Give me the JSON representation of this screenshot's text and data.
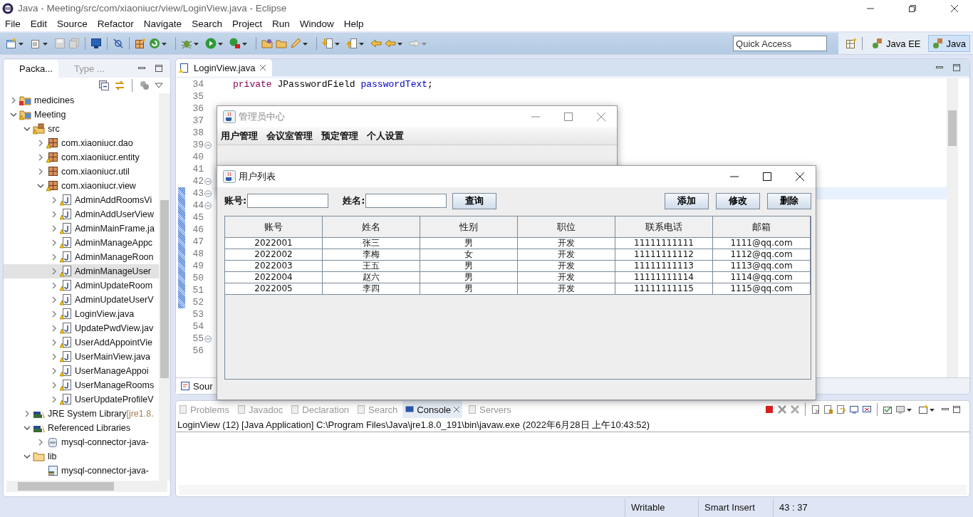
{
  "window": {
    "title": "Java - Meeting/src/com/xiaoniucr/view/LoginView.java - Eclipse"
  },
  "menu_bar": [
    "File",
    "Edit",
    "Source",
    "Refactor",
    "Navigate",
    "Search",
    "Project",
    "Run",
    "Window",
    "Help"
  ],
  "quick_access": {
    "placeholder": "Quick Access"
  },
  "perspectives": [
    {
      "label": "Java EE",
      "selected": false
    },
    {
      "label": "Java",
      "selected": true
    }
  ],
  "package_explorer": {
    "tabs": [
      {
        "label": "Packa...",
        "selected": true
      },
      {
        "label": "Type ...",
        "selected": false
      }
    ],
    "tree": [
      {
        "label": "medicines",
        "kind": "project",
        "warning": false,
        "error": true,
        "expanded": false,
        "selected": false
      },
      {
        "label": "Meeting",
        "kind": "project",
        "warning": true,
        "error": false,
        "expanded": true,
        "selected": false,
        "children": [
          {
            "label": "src",
            "kind": "source-folder",
            "warning": true,
            "error": false,
            "expanded": true,
            "selected": false,
            "children": [
              {
                "label": "com.xiaoniucr.dao",
                "kind": "package",
                "warning": true,
                "error": false,
                "expanded": false,
                "selected": false
              },
              {
                "label": "com.xiaoniucr.entity",
                "kind": "package",
                "warning": true,
                "error": false,
                "expanded": false,
                "selected": false
              },
              {
                "label": "com.xiaoniucr.util",
                "kind": "package",
                "warning": false,
                "error": false,
                "expanded": false,
                "selected": false
              },
              {
                "label": "com.xiaoniucr.view",
                "kind": "package",
                "warning": true,
                "error": false,
                "expanded": true,
                "selected": false,
                "children": [
                  {
                    "label": "AdminAddRoomsVi",
                    "kind": "java-file",
                    "warning": true,
                    "error": false,
                    "expanded": false,
                    "selected": false
                  },
                  {
                    "label": "AdminAddUserView",
                    "kind": "java-file",
                    "warning": true,
                    "error": false,
                    "expanded": false,
                    "selected": false
                  },
                  {
                    "label": "AdminMainFrame.ja",
                    "kind": "java-file",
                    "warning": true,
                    "error": false,
                    "expanded": false,
                    "selected": false
                  },
                  {
                    "label": "AdminManageAppc",
                    "kind": "java-file",
                    "warning": true,
                    "error": false,
                    "expanded": false,
                    "selected": false
                  },
                  {
                    "label": "AdminManageRoon",
                    "kind": "java-file",
                    "warning": true,
                    "error": false,
                    "expanded": false,
                    "selected": false
                  },
                  {
                    "label": "AdminManageUser",
                    "kind": "java-file",
                    "warning": true,
                    "error": false,
                    "expanded": false,
                    "selected": true
                  },
                  {
                    "label": "AdminUpdateRoom",
                    "kind": "java-file",
                    "warning": true,
                    "error": false,
                    "expanded": false,
                    "selected": false
                  },
                  {
                    "label": "AdminUpdateUserV",
                    "kind": "java-file",
                    "warning": true,
                    "error": false,
                    "expanded": false,
                    "selected": false
                  },
                  {
                    "label": "LoginView.java",
                    "kind": "java-file",
                    "warning": true,
                    "error": false,
                    "expanded": false,
                    "selected": false
                  },
                  {
                    "label": "UpdatePwdView.jav",
                    "kind": "java-file",
                    "warning": true,
                    "error": false,
                    "expanded": false,
                    "selected": false
                  },
                  {
                    "label": "UserAddAppointVie",
                    "kind": "java-file",
                    "warning": true,
                    "error": false,
                    "expanded": false,
                    "selected": false
                  },
                  {
                    "label": "UserMainView.java",
                    "kind": "java-file",
                    "warning": true,
                    "error": false,
                    "expanded": false,
                    "selected": false
                  },
                  {
                    "label": "UserManageAppoi",
                    "kind": "java-file",
                    "warning": true,
                    "error": false,
                    "expanded": false,
                    "selected": false
                  },
                  {
                    "label": "UserManageRooms",
                    "kind": "java-file",
                    "warning": true,
                    "error": false,
                    "expanded": false,
                    "selected": false
                  },
                  {
                    "label": "UserUpdateProfileV",
                    "kind": "java-file",
                    "warning": true,
                    "error": false,
                    "expanded": false,
                    "selected": false
                  }
                ]
              }
            ]
          },
          {
            "label": "JRE System Library",
            "suffix": "[jre1.8.",
            "kind": "library",
            "warning": false,
            "error": false,
            "expanded": false,
            "selected": false
          },
          {
            "label": "Referenced Libraries",
            "kind": "library",
            "warning": false,
            "error": false,
            "expanded": true,
            "selected": false,
            "children": [
              {
                "label": "mysql-connector-java-",
                "kind": "jar",
                "warning": false,
                "error": false,
                "expanded": false,
                "selected": false
              }
            ]
          },
          {
            "label": "lib",
            "kind": "folder",
            "warning": false,
            "error": false,
            "expanded": true,
            "selected": false,
            "children": [
              {
                "label": "mysql-connector-java-",
                "kind": "jar-file",
                "warning": false,
                "error": false,
                "selected": false
              }
            ]
          }
        ]
      }
    ]
  },
  "editor": {
    "tabs": [
      {
        "label": "LoginView.java",
        "selected": true
      }
    ],
    "lines": [
      {
        "number": "34",
        "code": [
          {
            "text": "private",
            "kind": "keyword"
          },
          {
            "text": " JPasswordField ",
            "kind": "plain"
          },
          {
            "text": "passwordText",
            "kind": "field"
          },
          {
            "text": ";",
            "kind": "plain"
          }
        ]
      },
      {
        "number": "35"
      },
      {
        "number": "36"
      },
      {
        "number": "37"
      },
      {
        "number": "38"
      },
      {
        "number": "39",
        "fold": true
      },
      {
        "number": "40"
      },
      {
        "number": "41"
      },
      {
        "number": "42",
        "fold": true
      },
      {
        "number": "43",
        "fold": true,
        "current": true,
        "changed": true
      },
      {
        "number": "44",
        "fold": true,
        "changed": true
      },
      {
        "number": "45",
        "changed": true
      },
      {
        "number": "46",
        "changed": true
      },
      {
        "number": "47",
        "changed": true
      },
      {
        "number": "48",
        "changed": true
      },
      {
        "number": "49",
        "changed": true
      },
      {
        "number": "50",
        "changed": true
      },
      {
        "number": "51",
        "changed": true
      },
      {
        "number": "52",
        "changed": true
      },
      {
        "number": "53"
      },
      {
        "number": "54"
      },
      {
        "number": "55",
        "fold": true
      },
      {
        "number": "56"
      }
    ],
    "bottom_tabs": [
      {
        "label": "Sour",
        "selected": true
      }
    ]
  },
  "console": {
    "tabs": [
      {
        "label": "Problems",
        "selected": false
      },
      {
        "label": "Javadoc",
        "selected": false
      },
      {
        "label": "Declaration",
        "selected": false
      },
      {
        "label": "Search",
        "selected": false
      },
      {
        "label": "Console",
        "selected": true
      },
      {
        "label": "Servers",
        "selected": false
      }
    ],
    "header": "LoginView (12) [Java Application] C:\\Program Files\\Java\\jre1.8.0_191\\bin\\javaw.exe (2022年6月28日 上午10:43:52)"
  },
  "status_bar": [
    "Writable",
    "Smart Insert",
    "43 : 37"
  ],
  "admin_window": {
    "title": "管理员中心",
    "active": false,
    "menus": [
      "用户管理",
      "会议室管理",
      "预定管理",
      "个人设置"
    ]
  },
  "user_list_window": {
    "title": "用户列表",
    "active": true,
    "search_fields": [
      {
        "label": "账号:"
      },
      {
        "label": "姓名:"
      }
    ],
    "search_button": "查询",
    "buttons": [
      "添加",
      "修改",
      "删除"
    ],
    "table": {
      "columns": [
        "账号",
        "姓名",
        "性别",
        "职位",
        "联系电话",
        "邮箱"
      ],
      "rows": [
        [
          "2022001",
          "张三",
          "男",
          "开发",
          "11111111111",
          "1111@qq.com"
        ],
        [
          "2022002",
          "李梅",
          "女",
          "开发",
          "11111111112",
          "1112@qq.com"
        ],
        [
          "2022003",
          "王五",
          "男",
          "开发",
          "11111111113",
          "1113@qq.com"
        ],
        [
          "2022004",
          "赵六",
          "男",
          "开发",
          "11111111114",
          "1114@qq.com"
        ],
        [
          "2022005",
          "李四",
          "男",
          "开发",
          "11111111115",
          "1115@qq.com"
        ]
      ]
    }
  }
}
